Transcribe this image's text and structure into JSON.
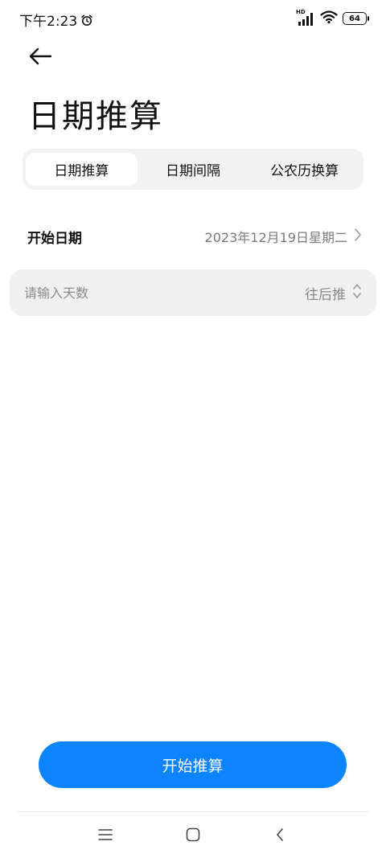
{
  "status_bar": {
    "time": "下午2:23",
    "network_label": "HD",
    "battery": "64"
  },
  "page": {
    "title": "日期推算"
  },
  "tabs": [
    {
      "label": "日期推算",
      "active": true
    },
    {
      "label": "日期间隔",
      "active": false
    },
    {
      "label": "公农历换算",
      "active": false
    }
  ],
  "start_date": {
    "label": "开始日期",
    "value": "2023年12月19日星期二"
  },
  "days_input": {
    "placeholder": "请输入天数",
    "value": ""
  },
  "direction": {
    "selected": "往后推"
  },
  "action": {
    "start_label": "开始推算"
  },
  "colors": {
    "accent": "#0d84ff",
    "tab_bg": "#f2f2f2",
    "input_bg": "#f0f0f0",
    "secondary_text": "#7a7a7a"
  },
  "icons": {
    "alarm": "alarm-clock-icon",
    "signal": "cellular-signal-icon",
    "wifi": "wifi-icon",
    "battery": "battery-icon",
    "back": "arrow-left-icon",
    "chevron": "chevron-right-icon",
    "updown": "chevron-up-down-icon",
    "menu": "menu-icon",
    "home": "home-square-icon",
    "nav_back": "nav-back-chevron-icon"
  }
}
